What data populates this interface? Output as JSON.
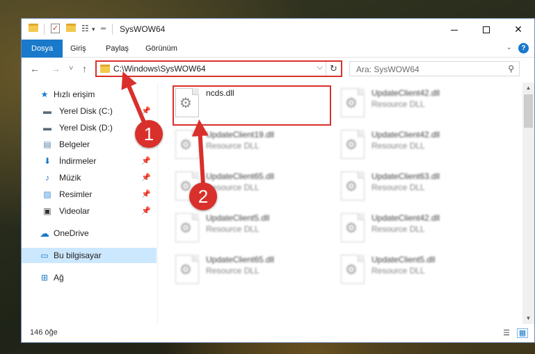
{
  "window": {
    "title": "SysWOW64",
    "min_glyph": "—",
    "close_glyph": "✕"
  },
  "quick_access": {
    "check_glyph": "✓",
    "props_glyph": "☷",
    "dropdown_glyph": "▾",
    "customize_glyph": "═"
  },
  "ribbon": {
    "tabs": [
      "Dosya",
      "Giriş",
      "Paylaş",
      "Görünüm"
    ],
    "active_tab": 0,
    "accent": "#1979ca",
    "chevron_glyph": "⌄",
    "help_glyph": "?"
  },
  "nav": {
    "back_glyph": "←",
    "forward_glyph": "→",
    "recent_glyph": "˅",
    "up_glyph": "↑",
    "address_value": "C:\\Windows\\SysWOW64",
    "addr_dropdown_glyph": "⌵",
    "refresh_glyph": "↻",
    "search_placeholder": "Ara: SysWOW64",
    "search_glyph": "⚲"
  },
  "sidebar": {
    "pin_glyph": "📌",
    "items": [
      {
        "label": "Hızlı erişim",
        "icon": "star-icon",
        "glyph": "★",
        "color": "#1979ca",
        "pinned": false
      },
      {
        "label": "Yerel Disk (C:)",
        "icon": "drive-c-icon",
        "glyph": "▬",
        "color": "#5a6b7a",
        "pinned": true
      },
      {
        "label": "Yerel Disk (D:)",
        "icon": "drive-d-icon",
        "glyph": "▬",
        "color": "#5a6b7a",
        "pinned": true
      },
      {
        "label": "Belgeler",
        "icon": "documents-icon",
        "glyph": "▤",
        "color": "#5a7fa8",
        "pinned": true
      },
      {
        "label": "İndirmeler",
        "icon": "downloads-icon",
        "glyph": "⬇",
        "color": "#1979ca",
        "pinned": true
      },
      {
        "label": "Müzik",
        "icon": "music-icon",
        "glyph": "♪",
        "color": "#1979ca",
        "pinned": true
      },
      {
        "label": "Resimler",
        "icon": "pictures-icon",
        "glyph": "▨",
        "color": "#3c8bd6",
        "pinned": true
      },
      {
        "label": "Videolar",
        "icon": "videos-icon",
        "glyph": "▣",
        "color": "#333333",
        "pinned": true
      },
      {
        "label": "OneDrive",
        "icon": "onedrive-icon",
        "glyph": "☁",
        "color": "#1979ca",
        "pinned": false
      },
      {
        "label": "Bu bilgisayar",
        "icon": "computer-icon",
        "glyph": "▭",
        "color": "#1979ca",
        "pinned": false,
        "selected": true
      },
      {
        "label": "Ağ",
        "icon": "network-icon",
        "glyph": "⊞",
        "color": "#1979ca",
        "pinned": false
      }
    ]
  },
  "files": [
    {
      "name": "ncds.dll",
      "type": "",
      "highlighted": true
    },
    {
      "name": "UpdateClient42.dll",
      "type": "Resource DLL"
    },
    {
      "name": "UpdateClient19.dll",
      "type": "Resource DLL"
    },
    {
      "name": "UpdateClient42.dll",
      "type": "Resource DLL"
    },
    {
      "name": "UpdateClient65.dll",
      "type": "Resource DLL"
    },
    {
      "name": "UpdateClient63.dll",
      "type": "Resource DLL"
    },
    {
      "name": "UpdateClient5.dll",
      "type": "Resource DLL"
    },
    {
      "name": "UpdateClient42.dll",
      "type": "Resource DLL"
    },
    {
      "name": "UpdateClient65.dll",
      "type": "Resource DLL"
    },
    {
      "name": "UpdateClient5.dll",
      "type": "Resource DLL"
    }
  ],
  "file_icon_glyph": "⚙",
  "scrollbar": {
    "up_glyph": "▲",
    "down_glyph": "▼"
  },
  "status": {
    "item_count": "146 öğe",
    "details_glyph": "☰",
    "tiles_glyph": "▦"
  },
  "callouts": [
    "1",
    "2"
  ],
  "colors": {
    "highlight": "#d9302c"
  }
}
